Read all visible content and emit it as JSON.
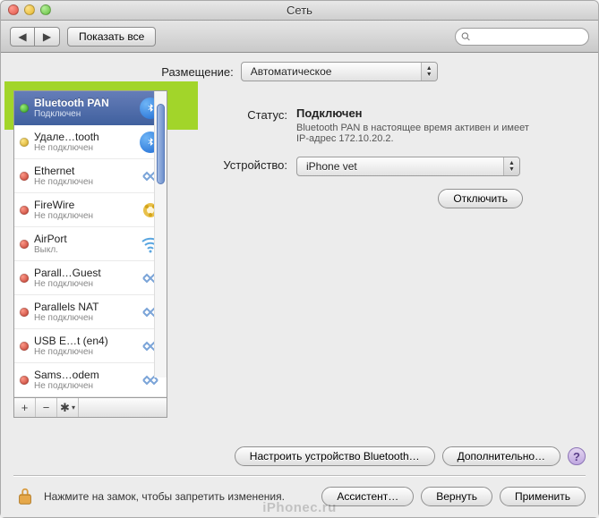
{
  "window": {
    "title": "Сеть"
  },
  "toolbar": {
    "back": "◀",
    "forward": "▶",
    "show_all": "Показать все",
    "search_placeholder": ""
  },
  "location": {
    "label": "Размещение:",
    "value": "Автоматическое"
  },
  "sidebar": {
    "items": [
      {
        "name": "Bluetooth PAN",
        "sub": "Подключен",
        "status": "green",
        "icon": "bluetooth",
        "selected": true
      },
      {
        "name": "Удале…tooth",
        "sub": "Не подключен",
        "status": "yellow",
        "icon": "bluetooth"
      },
      {
        "name": "Ethernet",
        "sub": "Не подключен",
        "status": "red",
        "icon": "ethernet"
      },
      {
        "name": "FireWire",
        "sub": "Не подключен",
        "status": "red",
        "icon": "firewire"
      },
      {
        "name": "AirPort",
        "sub": "Выкл.",
        "status": "red",
        "icon": "wifi"
      },
      {
        "name": "Parall…Guest",
        "sub": "Не подключен",
        "status": "red",
        "icon": "ethernet"
      },
      {
        "name": "Parallels NAT",
        "sub": "Не подключен",
        "status": "red",
        "icon": "ethernet"
      },
      {
        "name": "USB E…t (en4)",
        "sub": "Не подключен",
        "status": "red",
        "icon": "ethernet"
      },
      {
        "name": "Sams…odem",
        "sub": "Не подключен",
        "status": "red",
        "icon": "ethernet"
      }
    ],
    "add": "+",
    "remove": "−",
    "gear": "✱"
  },
  "details": {
    "status_label": "Статус:",
    "status_value": "Подключен",
    "status_desc": "Bluetooth PAN в настоящее время активен и имеет IP-адрес 172.10.20.2.",
    "device_label": "Устройство:",
    "device_value": "iPhone vet",
    "disconnect": "Отключить",
    "configure_bt": "Настроить устройство Bluetooth…",
    "advanced": "Дополнительно…",
    "help": "?"
  },
  "footer": {
    "lock_text": "Нажмите на замок, чтобы запретить изменения.",
    "assist": "Ассистент…",
    "revert": "Вернуть",
    "apply": "Применить"
  },
  "watermark": "iPhonec.ru"
}
